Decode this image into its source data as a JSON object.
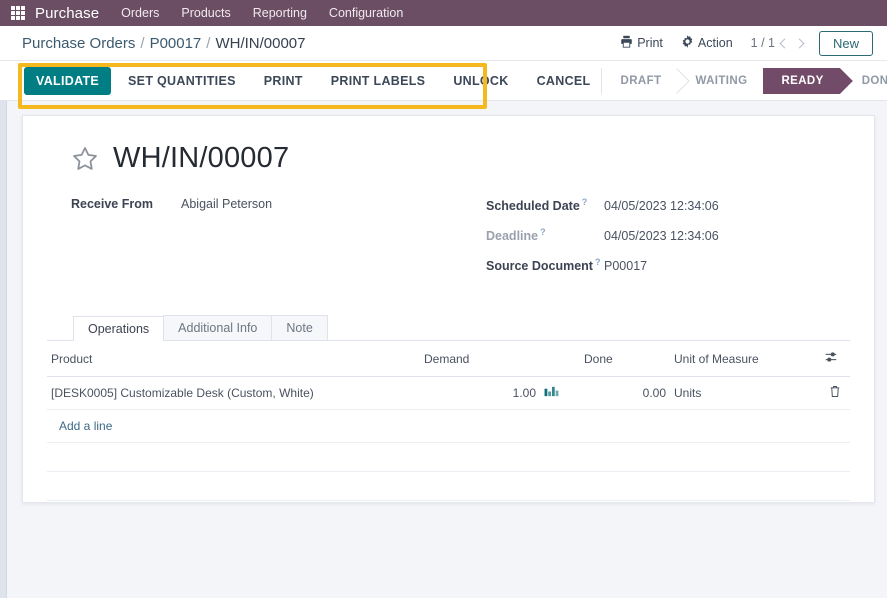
{
  "navbar": {
    "apps_icon": "apps-grid-icon",
    "brand": "Purchase",
    "menus": [
      "Orders",
      "Products",
      "Reporting",
      "Configuration"
    ]
  },
  "control_panel": {
    "breadcrumb": {
      "root": "Purchase Orders",
      "sep1": "/",
      "parent": "P00017",
      "sep2": "/",
      "current": "WH/IN/00007"
    },
    "print_label": "Print",
    "print_icon": "printer-icon",
    "action_label": "Action",
    "action_icon": "gear-icon",
    "pager": "1 / 1",
    "prev_icon": "chevron-left-icon",
    "next_icon": "chevron-right-icon",
    "new_label": "New"
  },
  "action_bar": {
    "buttons": [
      {
        "label": "VALIDATE",
        "primary": true
      },
      {
        "label": "SET QUANTITIES",
        "primary": false
      },
      {
        "label": "PRINT",
        "primary": false
      },
      {
        "label": "PRINT LABELS",
        "primary": false
      },
      {
        "label": "UNLOCK",
        "primary": false
      },
      {
        "label": "CANCEL",
        "primary": false
      }
    ],
    "highlight_color": "#f6b81f"
  },
  "statusbar": {
    "states": [
      "DRAFT",
      "WAITING",
      "READY",
      "DONE"
    ],
    "active": "READY",
    "active_color": "#714b67"
  },
  "record": {
    "star_icon": "star-outline-icon",
    "title": "WH/IN/00007",
    "left_fields": [
      {
        "label": "Receive From",
        "value": "Abigail Peterson",
        "help": false,
        "muted": false
      }
    ],
    "right_fields": [
      {
        "label": "Scheduled Date",
        "value": "04/05/2023 12:34:06",
        "help": "?",
        "muted": false
      },
      {
        "label": "Deadline",
        "value": "04/05/2023 12:34:06",
        "help": "?",
        "muted": true
      },
      {
        "label": "Source Document",
        "value": "P00017",
        "help": "?",
        "muted": false
      }
    ]
  },
  "notebook": {
    "tabs": [
      {
        "label": "Operations",
        "active": true
      },
      {
        "label": "Additional Info",
        "active": false
      },
      {
        "label": "Note",
        "active": false
      }
    ]
  },
  "lines_table": {
    "columns": {
      "product": "Product",
      "demand": "Demand",
      "done": "Done",
      "uom": "Unit of Measure",
      "options_icon": "sliders-icon"
    },
    "rows": [
      {
        "product": "[DESK0005] Customizable Desk (Custom, White)",
        "demand": "1.00",
        "forecast_icon": "bar-chart-icon",
        "done": "0.00",
        "uom": "Units",
        "delete_icon": "trash-icon"
      }
    ],
    "add_line_label": "Add a line",
    "empty_rows": 2
  }
}
